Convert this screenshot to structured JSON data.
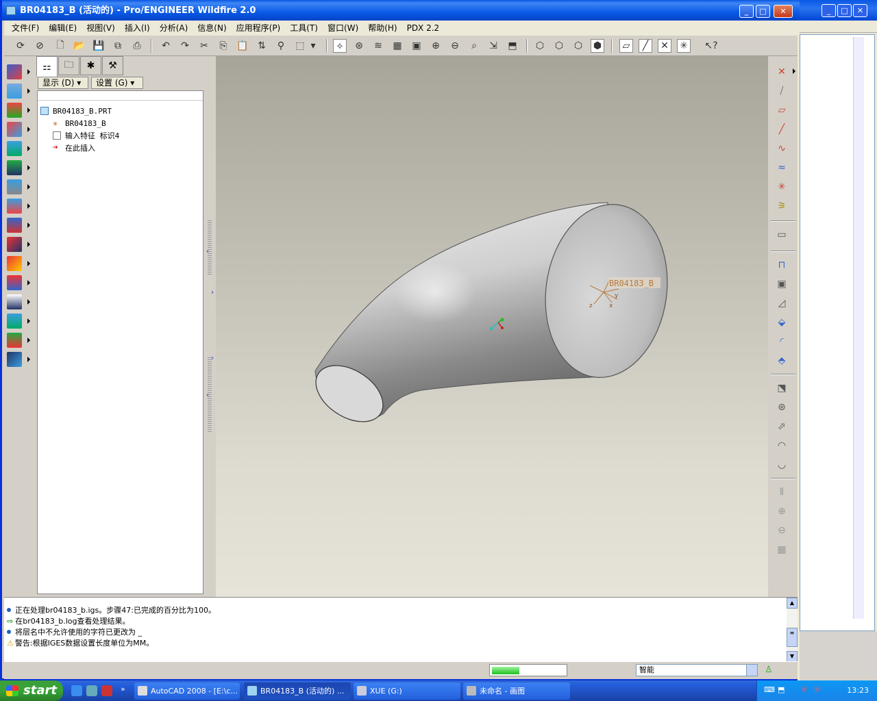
{
  "window": {
    "title": "BR04183_B (活动的) - Pro/ENGINEER Wildfire 2.0",
    "min": "_",
    "max": "□",
    "close": "✕"
  },
  "menu": [
    "文件(F)",
    "编辑(E)",
    "视图(V)",
    "插入(I)",
    "分析(A)",
    "信息(N)",
    "应用程序(P)",
    "工具(T)",
    "窗口(W)",
    "帮助(H)",
    "PDX 2.2"
  ],
  "nav": {
    "show_button": "显示 (D) ▾",
    "settings_button": "设置 (G) ▾",
    "tree": [
      {
        "label": "BR04183_B.PRT",
        "icon": "part-icon"
      },
      {
        "label": "BR04183_B",
        "icon": "csys-icon"
      },
      {
        "label": "输入特征 标识4",
        "icon": "import-feature-icon"
      },
      {
        "label": "在此插入",
        "icon": "insert-here-arrow-icon"
      }
    ]
  },
  "model": {
    "csys_label": "BR04183_B",
    "axis_y": "y",
    "axis_z": "z",
    "axis_x": "x",
    "surface_color": "#c8c8c8"
  },
  "messages": [
    {
      "text": "正在处理br04183_b.igs。步骤47:已完成的百分比为100。",
      "icon": "info-bullet"
    },
    {
      "text": "在br04183_b.log查看处理结果。",
      "icon": "green-arrow"
    },
    {
      "text": "将层名中不允许使用的字符已更改为 _",
      "icon": "info-bullet"
    },
    {
      "text": "警告:根据IGES数据设置长度单位为MM。",
      "icon": "warning-triangle"
    }
  ],
  "status": {
    "progress": 0.38,
    "filter_value": "智能"
  },
  "taskbar": {
    "start": "start",
    "tasks": [
      {
        "label": "AutoCAD 2008 - [E:\\c...",
        "active": false
      },
      {
        "label": "BR04183_B (活动的) ...",
        "active": true
      },
      {
        "label": "XUE (G:)",
        "active": false
      },
      {
        "label": "未命名 - 画图",
        "active": false
      }
    ],
    "clock": "13:23"
  },
  "colors": {
    "xp_blue": "#0a58e4",
    "accent_green": "#1fc01f"
  }
}
